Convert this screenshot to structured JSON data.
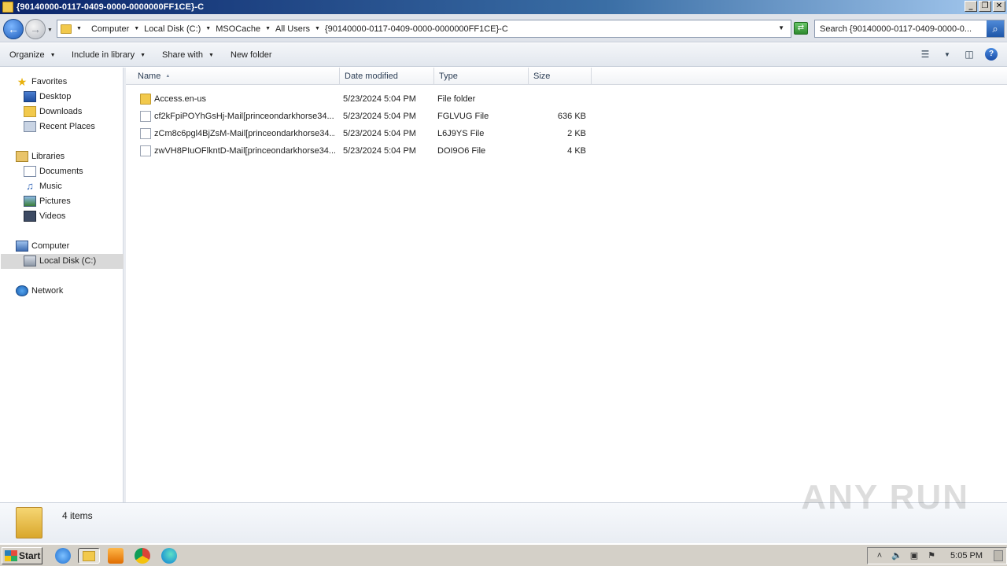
{
  "window": {
    "title": "{90140000-0117-0409-0000-0000000FF1CE}-C",
    "controls": {
      "minimize": "_",
      "maximize": "❐",
      "close": "✕"
    }
  },
  "address": {
    "breadcrumbs": [
      "Computer",
      "Local Disk (C:)",
      "MSOCache",
      "All Users",
      "{90140000-0117-0409-0000-0000000FF1CE}-C"
    ],
    "search_placeholder": "Search {90140000-0117-0409-0000-0..."
  },
  "toolbar": {
    "organize": "Organize",
    "include_in_library": "Include in library",
    "share_with": "Share with",
    "new_folder": "New folder"
  },
  "nav": {
    "favorites": "Favorites",
    "desktop": "Desktop",
    "downloads": "Downloads",
    "recent_places": "Recent Places",
    "libraries": "Libraries",
    "documents": "Documents",
    "music": "Music",
    "pictures": "Pictures",
    "videos": "Videos",
    "computer": "Computer",
    "local_disk": "Local Disk (C:)",
    "network": "Network"
  },
  "columns": {
    "name": "Name",
    "date": "Date modified",
    "type": "Type",
    "size": "Size"
  },
  "files": [
    {
      "name": "Access.en-us",
      "date": "5/23/2024 5:04 PM",
      "type": "File folder",
      "size": "",
      "icon": "folder-icon"
    },
    {
      "name": "cf2kFpiPOYhGsHj-Mail[princeondarkhorse34...",
      "date": "5/23/2024 5:04 PM",
      "type": "FGLVUG File",
      "size": "636 KB",
      "icon": "file-icon"
    },
    {
      "name": "zCm8c6pgl4BjZsM-Mail[princeondarkhorse34...",
      "date": "5/23/2024 5:04 PM",
      "type": "L6J9YS File",
      "size": "2 KB",
      "icon": "file-icon"
    },
    {
      "name": "zwVH8PIuOFlkntD-Mail[princeondarkhorse34...",
      "date": "5/23/2024 5:04 PM",
      "type": "DOI9O6 File",
      "size": "4 KB",
      "icon": "file-icon"
    }
  ],
  "details": {
    "item_count": "4 items"
  },
  "watermark": "ANY RUN",
  "taskbar": {
    "start": "Start",
    "clock": "5:05 PM"
  }
}
